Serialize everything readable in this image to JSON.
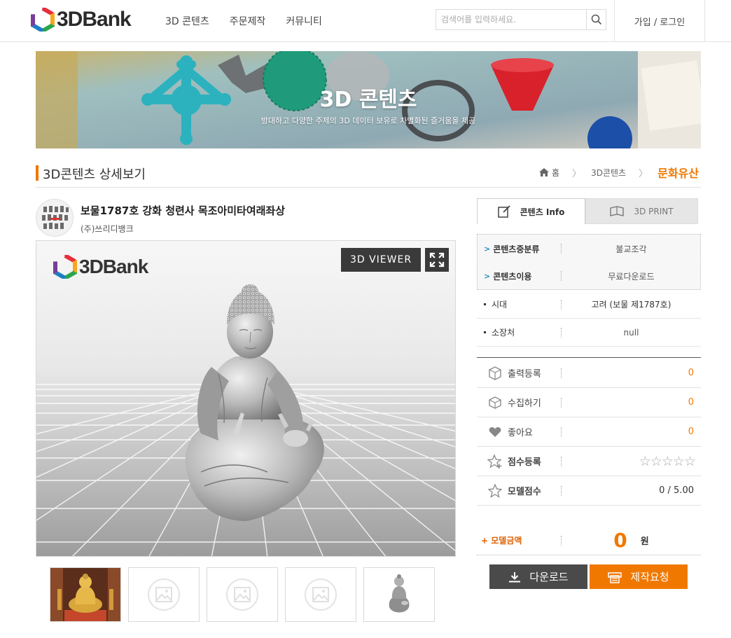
{
  "header": {
    "logo_text": "3DBank",
    "nav": [
      "3D 콘텐츠",
      "주문제작",
      "커뮤니티"
    ],
    "search_placeholder": "검색어를 입력하세요.",
    "login": "가입 / 로그인"
  },
  "banner": {
    "title": "3D 콘텐츠",
    "subtitle": "방대하고 다양한 주제의 3D 데이터 보유로 차별화된 즐거움을 제공"
  },
  "page": {
    "title": "3D콘텐츠 상세보기",
    "breadcrumb": [
      "홈",
      "3D콘텐츠",
      "문화유산"
    ]
  },
  "product": {
    "title": "보물1787호 강화 청련사 목조아미타여래좌상",
    "company": "(주)쓰리디뱅크"
  },
  "viewer": {
    "logo_text": "3DBank",
    "viewer_button": "3D VIEWER"
  },
  "tabs": [
    "콘텐츠 Info",
    "3D PRINT"
  ],
  "info": [
    {
      "label": "콘텐츠중분류",
      "value": "불교조각"
    },
    {
      "label": "콘텐츠이용",
      "value": "무료다운로드"
    },
    {
      "label": "시대",
      "value": "고려 (보물 제1787호)"
    },
    {
      "label": "소장처",
      "value": "null"
    }
  ],
  "stats": [
    {
      "icon": "box-print-icon",
      "label": "출력등록",
      "value": "0"
    },
    {
      "icon": "cube-icon",
      "label": "수집하기",
      "value": "0"
    },
    {
      "icon": "heart-icon",
      "label": "좋아요",
      "value": "0"
    },
    {
      "icon": "star-add-icon",
      "label": "점수등록",
      "value": "☆☆☆☆☆"
    },
    {
      "icon": "star-icon",
      "label": "모델점수",
      "value": "0 / 5.00"
    }
  ],
  "price": {
    "label": "+ 모델금액",
    "amount": "0",
    "unit": "원"
  },
  "buttons": {
    "download": "다운로드",
    "order": "제작요청"
  },
  "colors": {
    "accent": "#f07800",
    "dark": "#4a4a4a",
    "chevron": "#1f8fc4"
  }
}
